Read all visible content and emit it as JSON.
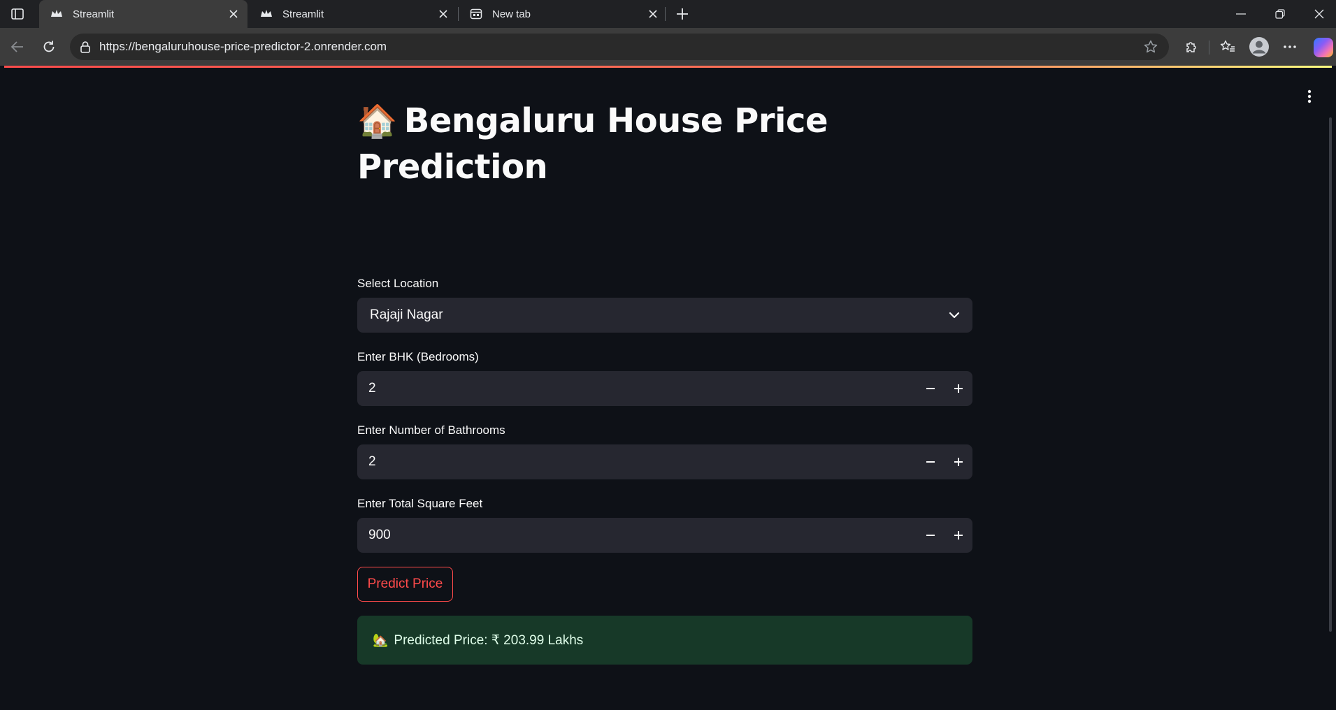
{
  "browser": {
    "tabs": [
      {
        "title": "Streamlit",
        "favicon": "streamlit-crown-icon",
        "active": true
      },
      {
        "title": "Streamlit",
        "favicon": "streamlit-crown-icon",
        "active": false
      },
      {
        "title": "New tab",
        "favicon": "newtab-icon",
        "active": false
      }
    ],
    "url": "https://bengaluruhouse-price-predictor-2.onrender.com"
  },
  "app": {
    "title_emoji": "🏠",
    "title": "Bengaluru House Price Prediction",
    "location": {
      "label": "Select Location",
      "value": "Rajaji Nagar"
    },
    "bhk": {
      "label": "Enter BHK (Bedrooms)",
      "value": "2"
    },
    "bath": {
      "label": "Enter Number of Bathrooms",
      "value": "2"
    },
    "sqft": {
      "label": "Enter Total Square Feet",
      "value": "900"
    },
    "predict_button": "Predict Price",
    "result": {
      "emoji": "🏡",
      "text": "Predicted Price: ₹ 203.99 Lakhs"
    }
  },
  "colors": {
    "background": "#0e1117",
    "input_bg": "#262730",
    "accent": "#ff4b4b",
    "success_bg": "#173928",
    "success_text": "#dffde9"
  }
}
